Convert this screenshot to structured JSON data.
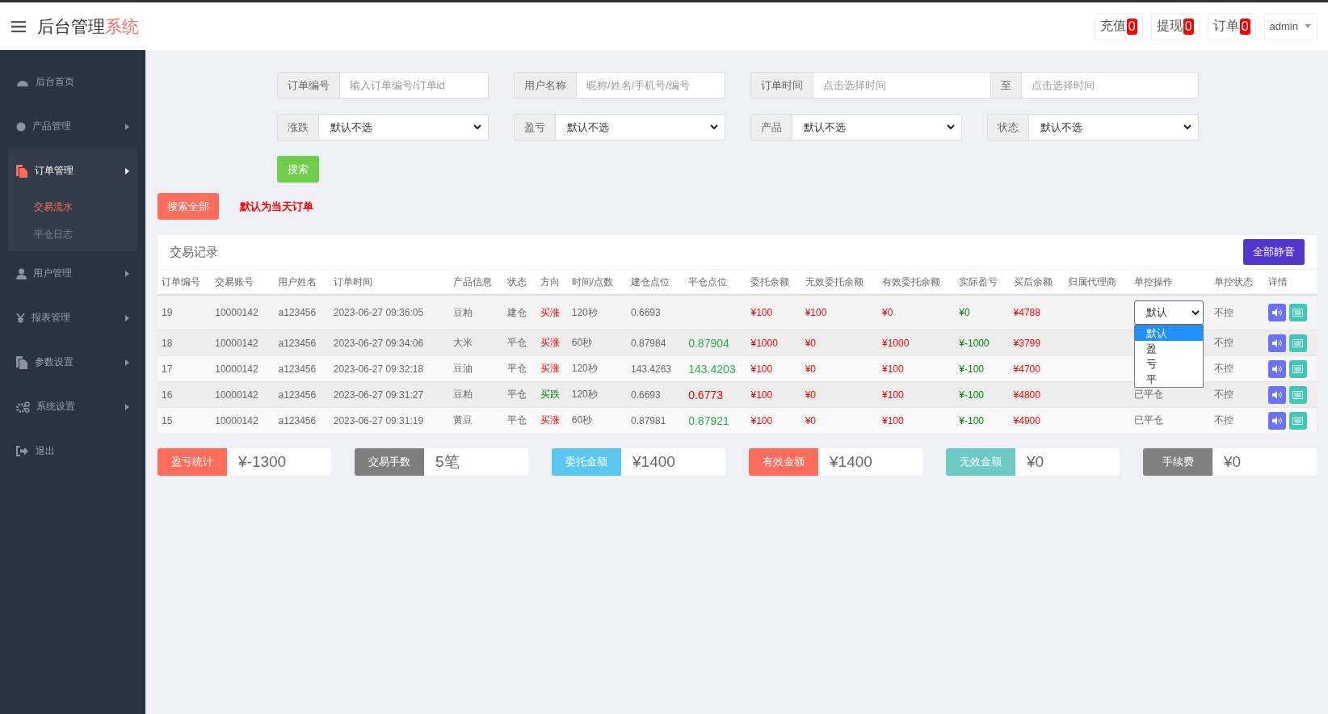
{
  "header": {
    "title": "后台管理",
    "title_accent": "系统",
    "counters": [
      {
        "label": "充值",
        "count": "0"
      },
      {
        "label": "提现",
        "count": "0"
      },
      {
        "label": "订单",
        "count": "0"
      }
    ],
    "user": "admin"
  },
  "sidebar": {
    "items": [
      {
        "label": "后台首页",
        "selected": false,
        "has_submenu": false
      },
      {
        "label": "产品管理",
        "selected": false,
        "has_submenu": true
      },
      {
        "label": "订单管理",
        "selected": true,
        "has_submenu": true,
        "expanded": true,
        "children": [
          {
            "label": "交易流水",
            "selected": true
          },
          {
            "label": "平仓日志",
            "selected": false
          }
        ]
      },
      {
        "label": "用户管理",
        "selected": false,
        "has_submenu": true
      },
      {
        "label": "报表管理",
        "selected": false,
        "has_submenu": true
      },
      {
        "label": "参数设置",
        "selected": false,
        "has_submenu": true
      },
      {
        "label": "系统设置",
        "selected": false,
        "has_submenu": true
      },
      {
        "label": "退出",
        "selected": false,
        "has_submenu": false
      }
    ]
  },
  "filters": {
    "text_fields": [
      {
        "label": "订单编号",
        "placeholder": "输入订单编号/订单id"
      },
      {
        "label": "用户名称",
        "placeholder": "昵称/姓名/手机号/编号"
      }
    ],
    "time_range": {
      "label": "订单时间",
      "from": {
        "placeholder": "点击选择时间"
      },
      "separator": "至",
      "to": {
        "placeholder": "点击选择时间"
      }
    },
    "selects": [
      {
        "label": "涨跌",
        "value": "默认不选"
      },
      {
        "label": "盈亏",
        "value": "默认不选"
      },
      {
        "label": "产品",
        "value": "默认不选"
      },
      {
        "label": "状态",
        "value": "默认不选"
      }
    ],
    "search_button": "搜索",
    "search_all_button": "搜索全部",
    "note": "默认为当天订单"
  },
  "table": {
    "title": "交易记录",
    "mute_all_button": "全部静音",
    "columns": [
      "订单编号",
      "交易账号",
      "用户姓名",
      "订单时间",
      "产品信息",
      "状态",
      "方向",
      "时间/点数",
      "建仓点位",
      "平仓点位",
      "委托余额",
      "无效委托余额",
      "有效委托余额",
      "实际盈亏",
      "买后余额",
      "归属代理商",
      "单控操作",
      "单控状态",
      "详情"
    ],
    "rows": [
      {
        "order_no": "19",
        "account": "10000142",
        "username": "a123456",
        "time": "2023-06-27 09:36:05",
        "product": "豆粕",
        "status": "建仓",
        "direction": "买涨",
        "direction_up": true,
        "duration": "120秒",
        "open_price": "0.6693",
        "amount": "¥100",
        "invalid_amount": "¥100",
        "valid_amount": "¥0",
        "actual_pnl": "¥0",
        "balance_after": "¥4788",
        "control": {
          "kind": "select",
          "value": "默认",
          "expanded": true,
          "options": [
            {
              "label": "默认",
              "selected": true
            },
            {
              "label": "盈",
              "selected": false
            },
            {
              "label": "亏",
              "selected": false
            },
            {
              "label": "平",
              "selected": false
            }
          ]
        },
        "control_status": "不控"
      },
      {
        "order_no": "18",
        "account": "10000142",
        "username": "a123456",
        "time": "2023-06-27 09:34:06",
        "product": "大米",
        "status": "平仓",
        "direction": "买涨",
        "direction_up": true,
        "duration": "60秒",
        "open_price": "0.87984",
        "close_price": "0.87904",
        "close_up": false,
        "amount": "¥1000",
        "invalid_amount": "¥0",
        "valid_amount": "¥1000",
        "actual_pnl": "¥-1000",
        "balance_after": "¥3799",
        "control_status": "不控"
      },
      {
        "order_no": "17",
        "account": "10000142",
        "username": "a123456",
        "time": "2023-06-27 09:32:18",
        "product": "豆油",
        "status": "平仓",
        "direction": "买涨",
        "direction_up": true,
        "duration": "120秒",
        "open_price": "143.4263",
        "close_price": "143.4203",
        "close_up": false,
        "amount": "¥100",
        "invalid_amount": "¥0",
        "valid_amount": "¥100",
        "actual_pnl": "¥-100",
        "balance_after": "¥4700",
        "control_status": "不控"
      },
      {
        "order_no": "16",
        "account": "10000142",
        "username": "a123456",
        "time": "2023-06-27 09:31:27",
        "product": "豆粕",
        "status": "平仓",
        "direction": "买跌",
        "direction_up": false,
        "duration": "120秒",
        "open_price": "0.6693",
        "close_price": "0.6773",
        "close_up": true,
        "amount": "¥100",
        "invalid_amount": "¥0",
        "valid_amount": "¥100",
        "actual_pnl": "¥-100",
        "balance_after": "¥4800",
        "control": {
          "kind": "text",
          "text": "已平仓"
        },
        "control_status": "不控"
      },
      {
        "order_no": "15",
        "account": "10000142",
        "username": "a123456",
        "time": "2023-06-27 09:31:19",
        "product": "黄豆",
        "status": "平仓",
        "direction": "买涨",
        "direction_up": true,
        "duration": "60秒",
        "open_price": "0.87981",
        "close_price": "0.87921",
        "close_up": false,
        "amount": "¥100",
        "invalid_amount": "¥0",
        "valid_amount": "¥100",
        "actual_pnl": "¥-100",
        "balance_after": "¥4900",
        "control": {
          "kind": "text",
          "text": "已平仓"
        },
        "control_status": "不控"
      }
    ]
  },
  "summary": [
    {
      "label": "盈亏统计",
      "value": "¥-1300",
      "color": "#ff6c5c"
    },
    {
      "label": "交易手数",
      "value": "5笔",
      "color": "#7f7f7f"
    },
    {
      "label": "委托金额",
      "value": "¥1400",
      "color": "#5bc7f0"
    },
    {
      "label": "有效金额",
      "value": "¥1400",
      "color": "#ff6c5c"
    },
    {
      "label": "无效金额",
      "value": "¥0",
      "color": "#6cc9c6"
    },
    {
      "label": "手续费",
      "value": "¥0",
      "color": "#808080"
    }
  ]
}
